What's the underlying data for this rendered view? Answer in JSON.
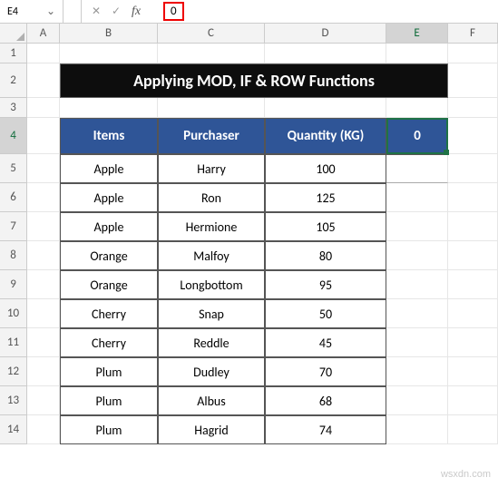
{
  "formula_bar": {
    "name_box": "E4",
    "dropdown_glyph": "⌄",
    "cancel_glyph": "✕",
    "enter_glyph": "✓",
    "fx_glyph": "fx",
    "value": "0"
  },
  "columns": [
    "A",
    "B",
    "C",
    "D",
    "E",
    "F"
  ],
  "row_numbers": [
    "1",
    "2",
    "3",
    "4",
    "5",
    "6",
    "7",
    "8",
    "9",
    "10",
    "11",
    "12",
    "13",
    "14"
  ],
  "title": "Applying MOD, IF & ROW Functions",
  "table": {
    "headers": {
      "items": "Items",
      "purchaser": "Purchaser",
      "quantity": "Quantity (KG)",
      "aux": "0"
    },
    "rows": [
      {
        "item": "Apple",
        "purchaser": "Harry",
        "qty": "100"
      },
      {
        "item": "Apple",
        "purchaser": "Ron",
        "qty": "125"
      },
      {
        "item": "Apple",
        "purchaser": "Hermione",
        "qty": "105"
      },
      {
        "item": "Orange",
        "purchaser": "Malfoy",
        "qty": "80"
      },
      {
        "item": "Orange",
        "purchaser": "Longbottom",
        "qty": "95"
      },
      {
        "item": "Cherry",
        "purchaser": "Snap",
        "qty": "50"
      },
      {
        "item": "Cherry",
        "purchaser": "Reddle",
        "qty": "45"
      },
      {
        "item": "Plum",
        "purchaser": "Dudley",
        "qty": "70"
      },
      {
        "item": "Plum",
        "purchaser": "Albus",
        "qty": "68"
      },
      {
        "item": "Plum",
        "purchaser": "Hagrid",
        "qty": "74"
      }
    ]
  },
  "active_cell": "E4",
  "watermark": "wsxdn.com",
  "chart_data": {
    "type": "table",
    "title": "Applying MOD, IF & ROW Functions",
    "columns": [
      "Items",
      "Purchaser",
      "Quantity (KG)"
    ],
    "rows": [
      [
        "Apple",
        "Harry",
        100
      ],
      [
        "Apple",
        "Ron",
        125
      ],
      [
        "Apple",
        "Hermione",
        105
      ],
      [
        "Orange",
        "Malfoy",
        80
      ],
      [
        "Orange",
        "Longbottom",
        95
      ],
      [
        "Cherry",
        "Snap",
        50
      ],
      [
        "Cherry",
        "Reddle",
        45
      ],
      [
        "Plum",
        "Dudley",
        70
      ],
      [
        "Plum",
        "Albus",
        68
      ],
      [
        "Plum",
        "Hagrid",
        74
      ]
    ]
  }
}
